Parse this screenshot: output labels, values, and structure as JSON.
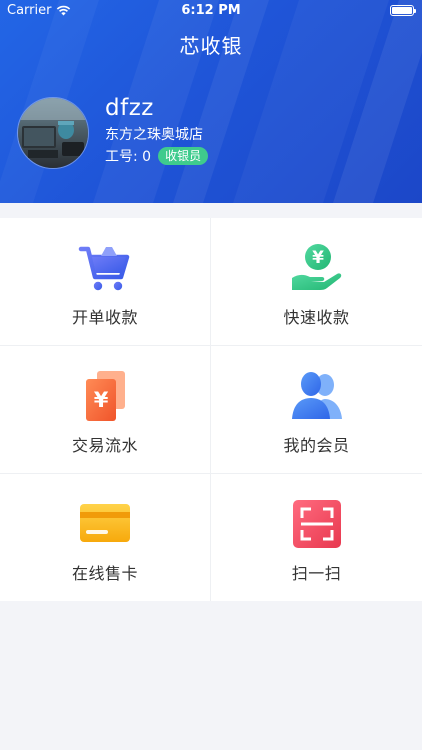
{
  "status_bar": {
    "carrier": "Carrier",
    "time": "6:12 PM"
  },
  "header": {
    "title": "芯收银"
  },
  "profile": {
    "username": "dfzz",
    "store": "东方之珠奥城店",
    "employee_id": "工号: 0",
    "role": "收银员"
  },
  "menu": [
    {
      "label": "开单收款",
      "icon": "shopping-cart-icon",
      "color": "#4f6ff5"
    },
    {
      "label": "快速收款",
      "icon": "hand-yen-coin-icon",
      "color": "#33c987"
    },
    {
      "label": "交易流水",
      "icon": "yen-documents-icon",
      "color": "#f2723c"
    },
    {
      "label": "我的会员",
      "icon": "members-icon",
      "color": "#3a7bf0"
    },
    {
      "label": "在线售卡",
      "icon": "card-icon",
      "color": "#f8c21c"
    },
    {
      "label": "扫一扫",
      "icon": "scan-icon",
      "color": "#f0506b"
    }
  ],
  "colors": {
    "header_blue": "#2366e6",
    "badge_green": "#3fcb8d",
    "background": "#f3f4f8"
  }
}
